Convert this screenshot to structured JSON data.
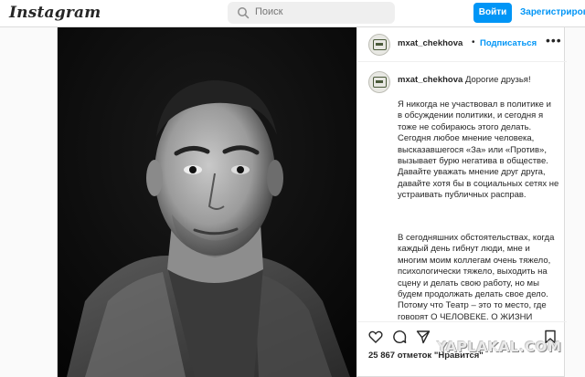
{
  "app": {
    "logo": "Instagram"
  },
  "search": {
    "placeholder": "Поиск"
  },
  "auth": {
    "login_label": "Войти",
    "signup_label": "Зарегистрироваться"
  },
  "post": {
    "username": "mxat_chekhova",
    "dot": "•",
    "follow_label": "Подписаться",
    "more_label": "•••",
    "caption_first": "Дорогие друзья!",
    "paragraph1": "Я никогда не участвовал в политике и\nв обсуждении политики, и сегодня я\nтоже не собираюсь этого делать.\nСегодня любое мнение человека,\nвысказавшегося «За» или «Против»,\nвызывает бурю негатива в обществе.\nДавайте уважать мнение друг друга,\nдавайте хотя бы в социальных сетях не\nустраивать публичных расправ.",
    "paragraph2": "В сегодняшних обстоятельствах, когда\nкаждый день гибнут люди, мне и\nмногим моим коллегам очень тяжело,\nпсихологически тяжело, выходить на\nсцену и делать свою работу, но мы\nбудем продолжать делать свое дело.\nПотому что Театр – это то место, где\nговорят О ЧЕЛОВЕКЕ, О ЖИЗНИ\nЧЕЛОВЕЧЕСКОГО ДУХА, О ЦЕННОСТИ\nЧЕЛОВЕЧЕСКОЙ ЖИЗНИ.",
    "likes": "25 867 отметок \"Нравится\""
  },
  "icons": {
    "search": "search-icon",
    "heart": "heart-icon",
    "comment": "comment-icon",
    "share": "share-icon",
    "save": "bookmark-icon"
  },
  "watermark": "YAPLAKAL.COM",
  "colors": {
    "accent": "#0095f6",
    "border": "#dbdbdb",
    "text": "#262626",
    "muted": "#8e8e8e"
  }
}
